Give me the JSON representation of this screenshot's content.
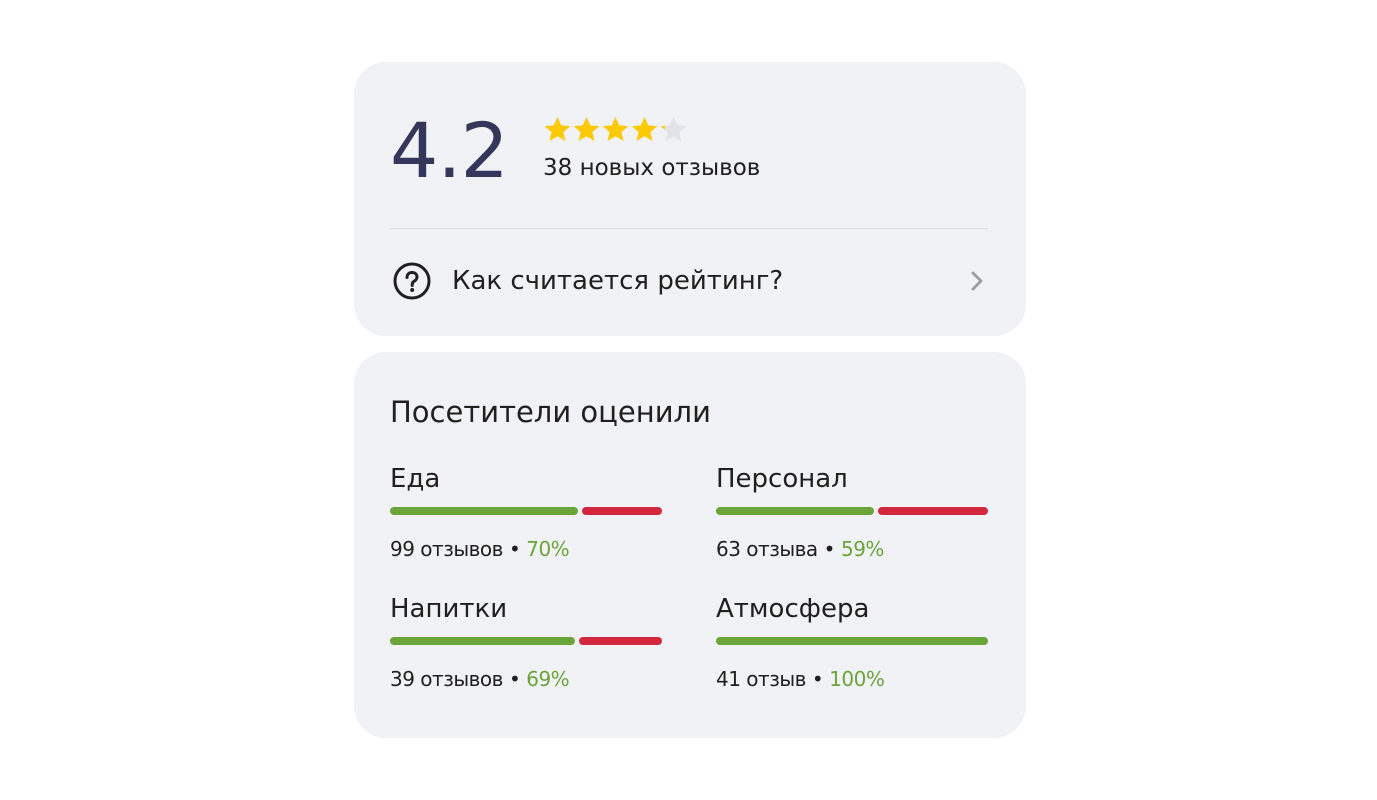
{
  "rating": {
    "value": "4.2",
    "stars_filled": 4.2,
    "stars_max": 5,
    "reviews_text": "38 новых отзывов"
  },
  "how_link": {
    "label": "Как считается рейтинг?",
    "icon": "question-circle-icon",
    "chevron": "chevron-right-icon"
  },
  "visitors": {
    "title": "Посетители оценили",
    "categories": [
      {
        "name": "Еда",
        "reviews": "99 отзывов",
        "separator": "•",
        "percent_text": "70%",
        "positive_fraction": 0.7
      },
      {
        "name": "Персонал",
        "reviews": "63 отзыва",
        "separator": "•",
        "percent_text": "59%",
        "positive_fraction": 0.59
      },
      {
        "name": "Напитки",
        "reviews": "39 отзывов",
        "separator": "•",
        "percent_text": "69%",
        "positive_fraction": 0.69
      },
      {
        "name": "Атмосфера",
        "reviews": "41 отзыв",
        "separator": "•",
        "percent_text": "100%",
        "positive_fraction": 1.0
      }
    ]
  },
  "colors": {
    "rating_text": "#34375a",
    "star_filled": "#fcca02",
    "star_empty": "#e1e3e8",
    "card_background": "#f0f2f5",
    "positive": "#6ba43a",
    "negative": "#d2273c"
  }
}
